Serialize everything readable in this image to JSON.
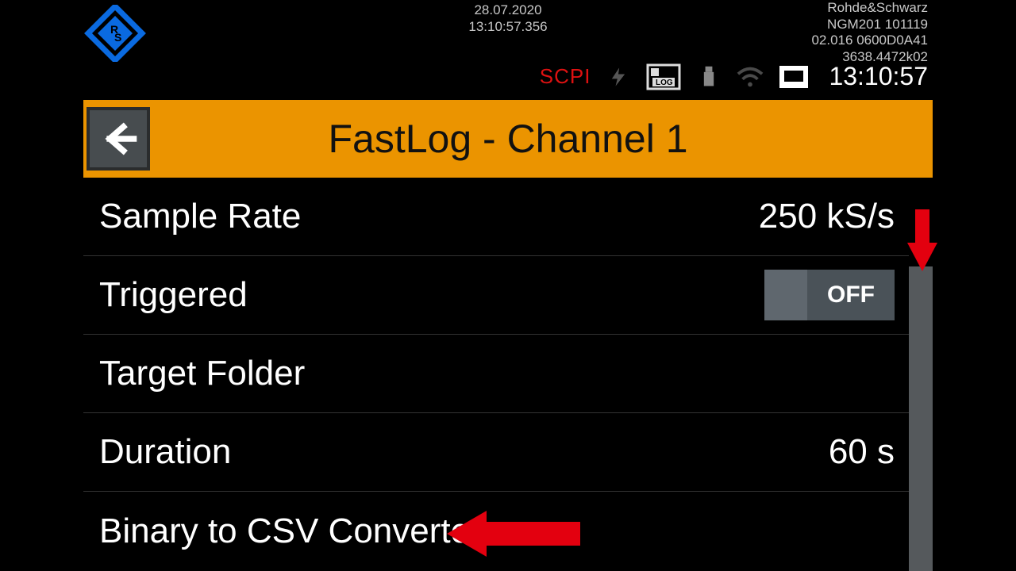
{
  "header": {
    "date": "28.07.2020",
    "time": "13:10:57.356",
    "device": {
      "vendor": "Rohde&Schwarz",
      "model": "NGM201 101119",
      "fw": "02.016 0600D0A41",
      "serial": "3638.4472k02"
    },
    "scpi_label": "SCPI",
    "clock": "13:10:57"
  },
  "title": "FastLog - Channel 1",
  "menu": {
    "sample_rate": {
      "label": "Sample Rate",
      "value": "250 kS/s"
    },
    "triggered": {
      "label": "Triggered",
      "toggle": "OFF"
    },
    "target_folder": {
      "label": "Target Folder",
      "value": ""
    },
    "duration": {
      "label": "Duration",
      "value": "60 s"
    },
    "bin2csv": {
      "label": "Binary to CSV Converter",
      "value": ""
    }
  }
}
